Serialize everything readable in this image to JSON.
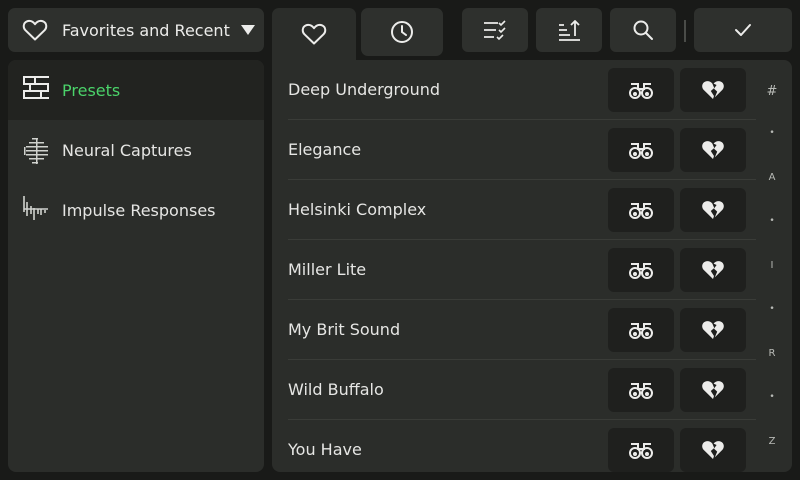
{
  "dropdown": {
    "label": "Favorites and Recent",
    "icon": "heart-outline-icon"
  },
  "tabs": [
    {
      "name": "favorites",
      "icon": "heart-outline-icon",
      "active": true
    },
    {
      "name": "recent",
      "icon": "clock-icon",
      "active": false
    }
  ],
  "toolbar": {
    "filter_icon": "filter-list-check-icon",
    "sort_icon": "sort-icon",
    "search_icon": "search-icon",
    "confirm_icon": "check-icon"
  },
  "sidebar": {
    "items": [
      {
        "label": "Presets",
        "icon": "presets-grid-icon",
        "active": true
      },
      {
        "label": "Neural Captures",
        "icon": "neural-capture-icon",
        "active": false
      },
      {
        "label": "Impulse Responses",
        "icon": "impulse-response-icon",
        "active": false
      }
    ]
  },
  "list": {
    "items": [
      {
        "label": "Deep Underground"
      },
      {
        "label": "Elegance"
      },
      {
        "label": "Helsinki Complex"
      },
      {
        "label": "Miller Lite"
      },
      {
        "label": "My Brit Sound"
      },
      {
        "label": "Wild Buffalo"
      },
      {
        "label": "You Have"
      }
    ],
    "view_icon": "binoculars-icon",
    "unfavorite_icon": "broken-heart-icon"
  },
  "alpha_index": [
    "#",
    "•",
    "A",
    "•",
    "I",
    "•",
    "R",
    "•",
    "Z"
  ],
  "colors": {
    "accent": "#4bd36a",
    "background": "#191a18",
    "panel": "#2b2d2a"
  }
}
